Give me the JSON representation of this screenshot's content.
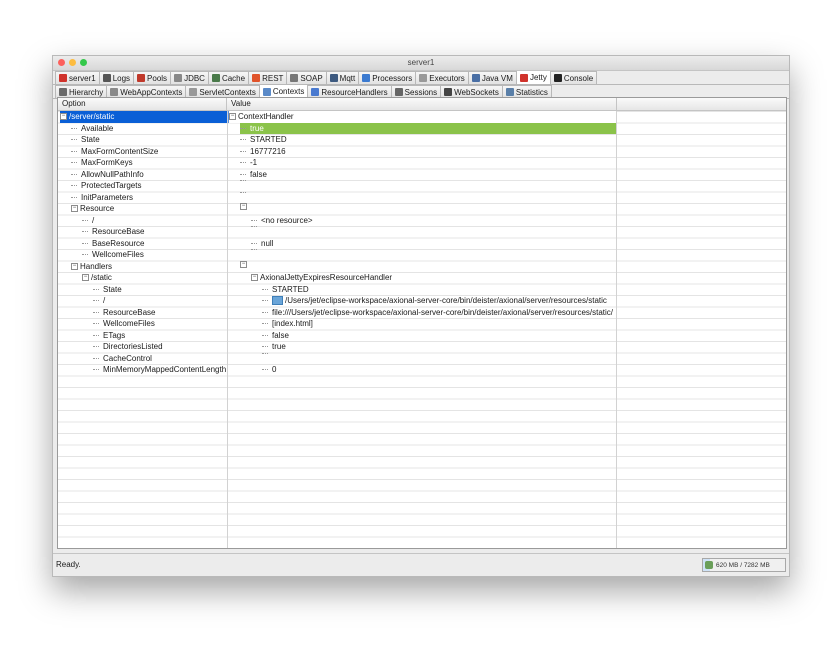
{
  "window": {
    "title": "server1"
  },
  "tabs_primary": [
    {
      "label": "server1",
      "icon": "server-icon",
      "color": "#d0332c"
    },
    {
      "label": "Logs",
      "icon": "log-icon",
      "color": "#555555"
    },
    {
      "label": "Pools",
      "icon": "pool-icon",
      "color": "#c0392b"
    },
    {
      "label": "JDBC",
      "icon": "database-icon",
      "color": "#888888"
    },
    {
      "label": "Cache",
      "icon": "cache-icon",
      "color": "#4a7a4a"
    },
    {
      "label": "REST",
      "icon": "rest-icon",
      "color": "#e0532a"
    },
    {
      "label": "SOAP",
      "icon": "soap-icon",
      "color": "#777777"
    },
    {
      "label": "Mqtt",
      "icon": "mqtt-icon",
      "color": "#3d5a80"
    },
    {
      "label": "Processors",
      "icon": "processor-icon",
      "color": "#3b7ad0"
    },
    {
      "label": "Executors",
      "icon": "gear-icon",
      "color": "#999999"
    },
    {
      "label": "Java VM",
      "icon": "java-icon",
      "color": "#4a6fa5"
    },
    {
      "label": "Jetty",
      "icon": "jetty-icon",
      "color": "#d0332c",
      "active": true
    },
    {
      "label": "Console",
      "icon": "console-icon",
      "color": "#222222"
    }
  ],
  "tabs_secondary": [
    {
      "label": "Hierarchy",
      "icon": "hierarchy-icon",
      "color": "#6b6b6b"
    },
    {
      "label": "WebAppContexts",
      "icon": "webapp-icon",
      "color": "#8a8a8a"
    },
    {
      "label": "ServletContexts",
      "icon": "servlet-icon",
      "color": "#999999"
    },
    {
      "label": "Contexts",
      "icon": "context-icon",
      "color": "#5a8ac8",
      "active": true
    },
    {
      "label": "ResourceHandlers",
      "icon": "resource-icon",
      "color": "#4a7ad0"
    },
    {
      "label": "Sessions",
      "icon": "session-icon",
      "color": "#666666"
    },
    {
      "label": "WebSockets",
      "icon": "websocket-icon",
      "color": "#444444"
    },
    {
      "label": "Statistics",
      "icon": "stats-icon",
      "color": "#5a7fa8"
    }
  ],
  "table": {
    "columns": [
      "Option",
      "Value"
    ],
    "rows": [
      {
        "option": "/server/static",
        "value": "ContextHandler",
        "level": 0,
        "vlevel": 0,
        "expander": "-",
        "vexpander": "-",
        "selected": true
      },
      {
        "option": "Available",
        "value": "true",
        "level": 1,
        "vlevel": 1,
        "highlight": true
      },
      {
        "option": "State",
        "value": "STARTED",
        "level": 1,
        "vlevel": 1
      },
      {
        "option": "MaxFormContentSize",
        "value": "16777216",
        "level": 1,
        "vlevel": 1
      },
      {
        "option": "MaxFormKeys",
        "value": "-1",
        "level": 1,
        "vlevel": 1
      },
      {
        "option": "AllowNullPathInfo",
        "value": "false",
        "level": 1,
        "vlevel": 1
      },
      {
        "option": "ProtectedTargets",
        "value": "",
        "level": 1,
        "vlevel": 1
      },
      {
        "option": "InitParameters",
        "value": "",
        "level": 1,
        "vlevel": 1
      },
      {
        "option": "Resource",
        "value": "",
        "level": 1,
        "vlevel": 1,
        "expander": "-",
        "vexpander": "-"
      },
      {
        "option": "/",
        "value": "<no resource>",
        "level": 2,
        "vlevel": 2
      },
      {
        "option": "ResourceBase",
        "value": "",
        "level": 2,
        "vlevel": 2
      },
      {
        "option": "BaseResource",
        "value": "null",
        "level": 2,
        "vlevel": 2
      },
      {
        "option": "WellcomeFiles",
        "value": "",
        "level": 2,
        "vlevel": 2
      },
      {
        "option": "Handlers",
        "value": "",
        "level": 1,
        "vlevel": 1,
        "expander": "-",
        "vexpander": "-"
      },
      {
        "option": "/static",
        "value": "AxionalJettyExpiresResourceHandler",
        "level": 2,
        "vlevel": 2,
        "expander": "-",
        "vexpander": "-"
      },
      {
        "option": "State",
        "value": "STARTED",
        "level": 3,
        "vlevel": 3
      },
      {
        "option": "/",
        "value": "/Users/jet/eclipse-workspace/axional-server-core/bin/deister/axional/server/resources/static",
        "level": 3,
        "vlevel": 3,
        "folder": true
      },
      {
        "option": "ResourceBase",
        "value": "file:///Users/jet/eclipse-workspace/axional-server-core/bin/deister/axional/server/resources/static/",
        "level": 3,
        "vlevel": 3
      },
      {
        "option": "WellcomeFiles",
        "value": "[index.html]",
        "level": 3,
        "vlevel": 3
      },
      {
        "option": "ETags",
        "value": "false",
        "level": 3,
        "vlevel": 3
      },
      {
        "option": "DirectoriesListed",
        "value": "true",
        "level": 3,
        "vlevel": 3
      },
      {
        "option": "CacheControl",
        "value": "",
        "level": 3,
        "vlevel": 3
      },
      {
        "option": "MinMemoryMappedContentLength",
        "value": "0",
        "level": 3,
        "vlevel": 3
      }
    ]
  },
  "status": {
    "text": "Ready.",
    "memory": "620 MB / 7282 MB",
    "memory_fraction": 0.085
  }
}
